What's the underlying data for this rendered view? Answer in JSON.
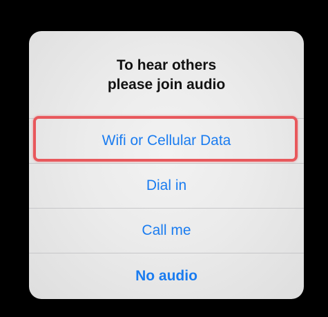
{
  "alert": {
    "title_line1": "To hear others",
    "title_line2": "please join audio",
    "actions": [
      {
        "label": "Wifi or Cellular Data"
      },
      {
        "label": "Dial in"
      },
      {
        "label": "Call me"
      },
      {
        "label": "No audio"
      }
    ]
  },
  "colors": {
    "action_text": "#1a7cf0",
    "highlight_border": "#e8585c",
    "background": "#000000"
  }
}
